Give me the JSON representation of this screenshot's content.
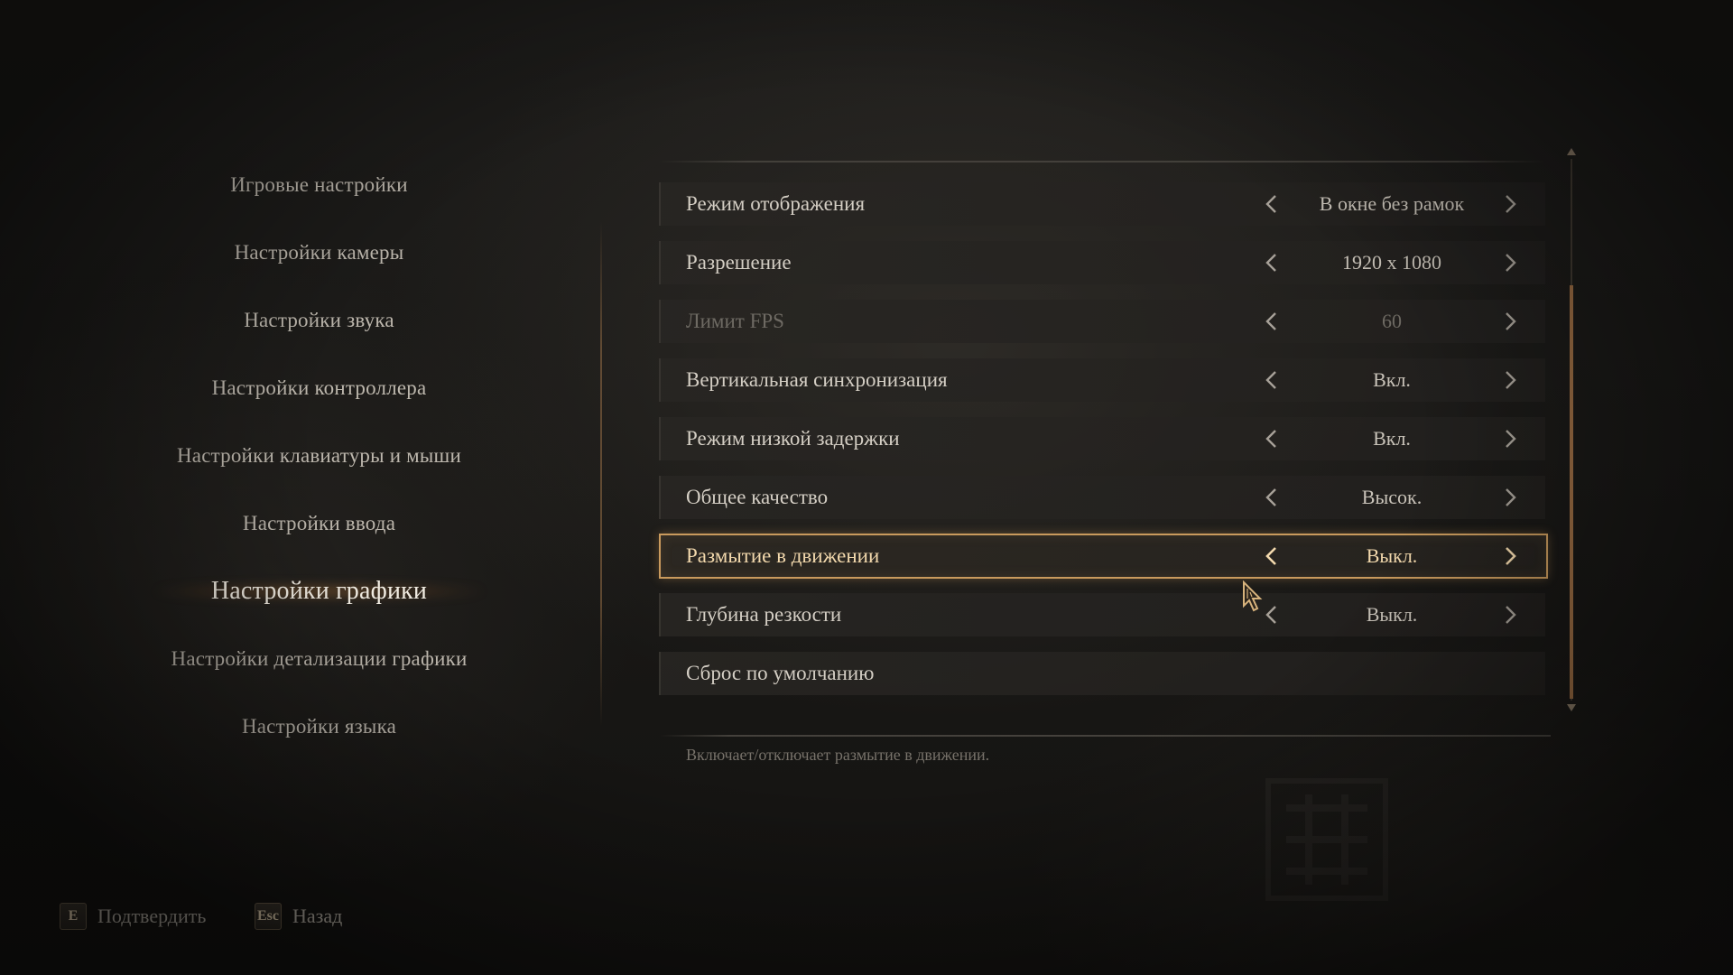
{
  "nav": {
    "items": [
      {
        "label": "Игровые настройки",
        "active": false
      },
      {
        "label": "Настройки камеры",
        "active": false
      },
      {
        "label": "Настройки звука",
        "active": false
      },
      {
        "label": "Настройки контроллера",
        "active": false
      },
      {
        "label": "Настройки клавиатуры и мыши",
        "active": false
      },
      {
        "label": "Настройки ввода",
        "active": false
      },
      {
        "label": "Настройки графики",
        "active": true
      },
      {
        "label": "Настройки детализации графики",
        "active": false
      },
      {
        "label": "Настройки языка",
        "active": false
      }
    ]
  },
  "settings": {
    "rows": [
      {
        "label": "Режим отображения",
        "value": "В окне без рамок",
        "state": "normal"
      },
      {
        "label": "Разрешение",
        "value": "1920 x 1080",
        "state": "normal"
      },
      {
        "label": "Лимит FPS",
        "value": "60",
        "state": "disabled"
      },
      {
        "label": "Вертикальная синхронизация",
        "value": "Вкл.",
        "state": "normal"
      },
      {
        "label": "Режим низкой задержки",
        "value": "Вкл.",
        "state": "normal"
      },
      {
        "label": "Общее качество",
        "value": "Высок.",
        "state": "normal"
      },
      {
        "label": "Размытие в движении",
        "value": "Выкл.",
        "state": "selected"
      },
      {
        "label": "Глубина резкости",
        "value": "Выкл.",
        "state": "normal"
      },
      {
        "label": "Сброс по умолчанию",
        "value": "",
        "state": "action"
      }
    ],
    "description": "Включает/отключает размытие в движении."
  },
  "footer": {
    "confirm": {
      "key": "E",
      "label": "Подтвердить"
    },
    "back": {
      "key": "Esc",
      "label": "Назад"
    }
  },
  "colors": {
    "accent": "#c99a5d",
    "selected_text": "#f3d9ad",
    "scroll_thumb": "#9a6c43",
    "arrow_normal": "#9f9a92",
    "arrow_selected": "#f3d9ad"
  },
  "icons": {
    "prev": "chevron-left-icon",
    "next": "chevron-right-icon",
    "scroll_up": "triangle-up-icon",
    "scroll_down": "triangle-down-icon",
    "cursor": "mouse-cursor-icon"
  }
}
